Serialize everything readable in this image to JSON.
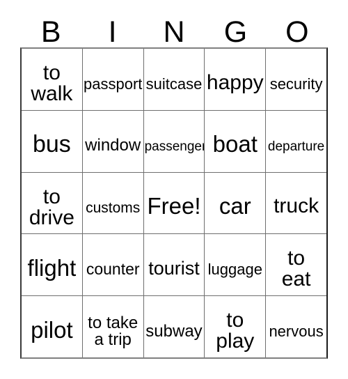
{
  "card": {
    "type": "bingo-card",
    "columns": 5,
    "rows": 5,
    "free_space_text": "Free!",
    "free_space_position": "center",
    "background_color": "#ffffff",
    "text_color": "#000000",
    "grid_line_color": "#6e6e6e"
  },
  "header": {
    "letters": [
      "B",
      "I",
      "N",
      "G",
      "O"
    ]
  },
  "grid": {
    "rows": [
      {
        "cells": [
          {
            "text": "to\nwalk",
            "lines": 2,
            "size": 30
          },
          {
            "text": "passport",
            "lines": 1,
            "size": 22
          },
          {
            "text": "suitcase",
            "lines": 1,
            "size": 22
          },
          {
            "text": "happy",
            "lines": 1,
            "size": 30
          },
          {
            "text": "security",
            "lines": 1,
            "size": 22
          }
        ]
      },
      {
        "cells": [
          {
            "text": "bus",
            "lines": 1,
            "size": 34
          },
          {
            "text": "window",
            "lines": 1,
            "size": 24
          },
          {
            "text": "passenger",
            "lines": 1,
            "size": 19
          },
          {
            "text": "boat",
            "lines": 1,
            "size": 33
          },
          {
            "text": "departure",
            "lines": 1,
            "size": 19
          }
        ]
      },
      {
        "cells": [
          {
            "text": "to\ndrive",
            "lines": 2,
            "size": 30
          },
          {
            "text": "customs",
            "lines": 1,
            "size": 21
          },
          {
            "text": "Free!",
            "lines": 1,
            "size": 33
          },
          {
            "text": "car",
            "lines": 1,
            "size": 33
          },
          {
            "text": "truck",
            "lines": 1,
            "size": 30
          }
        ]
      },
      {
        "cells": [
          {
            "text": "flight",
            "lines": 1,
            "size": 33
          },
          {
            "text": "counter",
            "lines": 1,
            "size": 23
          },
          {
            "text": "tourist",
            "lines": 1,
            "size": 27
          },
          {
            "text": "luggage",
            "lines": 1,
            "size": 22
          },
          {
            "text": "to\neat",
            "lines": 2,
            "size": 30
          }
        ]
      },
      {
        "cells": [
          {
            "text": "pilot",
            "lines": 1,
            "size": 33
          },
          {
            "text": "to take\na trip",
            "lines": 2,
            "size": 24
          },
          {
            "text": "subway",
            "lines": 1,
            "size": 24
          },
          {
            "text": "to\nplay",
            "lines": 2,
            "size": 30
          },
          {
            "text": "nervous",
            "lines": 1,
            "size": 22
          }
        ]
      }
    ]
  }
}
